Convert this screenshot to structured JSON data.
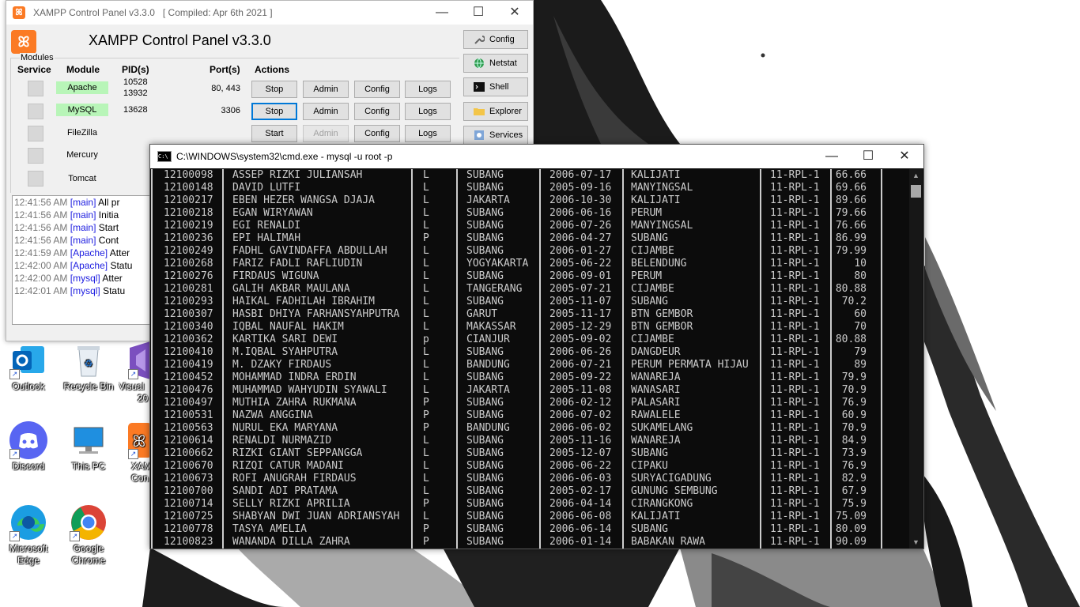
{
  "xampp": {
    "window_title": "XAMPP Control Panel v3.3.0   [ Compiled: Apr 6th 2021 ]",
    "heading": "XAMPP Control Panel v3.3.0",
    "modules_label": "Modules",
    "headers": {
      "service": "Service",
      "module": "Module",
      "pids": "PID(s)",
      "ports": "Port(s)",
      "actions": "Actions"
    },
    "modules": [
      {
        "name": "Apache",
        "running": true,
        "pid1": "10528",
        "pid2": "13932",
        "port": "80, 443",
        "toggle": "Stop",
        "admin": "Admin",
        "config": "Config",
        "logs": "Logs"
      },
      {
        "name": "MySQL",
        "running": true,
        "pid1": "13628",
        "pid2": "",
        "port": "3306",
        "toggle": "Stop",
        "admin": "Admin",
        "config": "Config",
        "logs": "Logs"
      },
      {
        "name": "FileZilla",
        "running": false,
        "pid1": "",
        "pid2": "",
        "port": "",
        "toggle": "Start",
        "admin": "Admin",
        "config": "Config",
        "logs": "Logs"
      },
      {
        "name": "Mercury",
        "running": false
      },
      {
        "name": "Tomcat",
        "running": false
      }
    ],
    "side_buttons": [
      "Config",
      "Netstat",
      "Shell",
      "Explorer",
      "Services"
    ],
    "log": [
      {
        "time": "12:41:56 AM",
        "module": "[main]",
        "text": "All pr"
      },
      {
        "time": "12:41:56 AM",
        "module": "[main]",
        "text": "Initia"
      },
      {
        "time": "12:41:56 AM",
        "module": "[main]",
        "text": "Start"
      },
      {
        "time": "12:41:56 AM",
        "module": "[main]",
        "text": "Cont"
      },
      {
        "time": "12:41:59 AM",
        "module": "[Apache]",
        "text": "Atter"
      },
      {
        "time": "12:42:00 AM",
        "module": "[Apache]",
        "text": "Statu"
      },
      {
        "time": "12:42:00 AM",
        "module": "[mysql]",
        "text": "Atter"
      },
      {
        "time": "12:42:01 AM",
        "module": "[mysql]",
        "text": "Statu"
      }
    ]
  },
  "cmd": {
    "title": "C:\\WINDOWS\\system32\\cmd.exe - mysql  -u root -p",
    "rows": [
      [
        "12100098",
        "ASSEP RIZKI JULIANSAH",
        "L",
        "SUBANG",
        "2006-07-17",
        "KALIJATI",
        "11-RPL-1",
        "66.66"
      ],
      [
        "12100148",
        "DAVID LUTFI",
        "L",
        "SUBANG",
        "2005-09-16",
        "MANYINGSAL",
        "11-RPL-1",
        "69.66"
      ],
      [
        "12100217",
        "EBEN HEZER WANGSA DJAJA",
        "L",
        "JAKARTA",
        "2006-10-30",
        "KALIJATI",
        "11-RPL-1",
        "89.66"
      ],
      [
        "12100218",
        "EGAN WIRYAWAN",
        "L",
        "SUBANG",
        "2006-06-16",
        "PERUM",
        "11-RPL-1",
        "79.66"
      ],
      [
        "12100219",
        "EGI RENALDI",
        "L",
        "SUBANG",
        "2006-07-26",
        "MANYINGSAL",
        "11-RPL-1",
        "76.66"
      ],
      [
        "12100236",
        "EPI HALIMAH",
        "P",
        "SUBANG",
        "2006-04-27",
        "SUBANG",
        "11-RPL-1",
        "86.99"
      ],
      [
        "12100249",
        "FADHL GAVINDAFFA ABDULLAH",
        "L",
        "SUBANG",
        "2006-01-27",
        "CIJAMBE",
        "11-RPL-1",
        "79.99"
      ],
      [
        "12100268",
        "FARIZ FADLI RAFLIUDIN",
        "L",
        "YOGYAKARTA",
        "2005-06-22",
        "BELENDUNG",
        "11-RPL-1",
        "10"
      ],
      [
        "12100276",
        "FIRDAUS WIGUNA",
        "L",
        "SUBANG",
        "2006-09-01",
        "PERUM",
        "11-RPL-1",
        "80"
      ],
      [
        "12100281",
        "GALIH AKBAR MAULANA",
        "L",
        "TANGERANG",
        "2005-07-21",
        "CIJAMBE",
        "11-RPL-1",
        "80.88"
      ],
      [
        "12100293",
        "HAIKAL FADHILAH IBRAHIM",
        "L",
        "SUBANG",
        "2005-11-07",
        "SUBANG",
        "11-RPL-1",
        "70.2"
      ],
      [
        "12100307",
        "HASBI DHIYA FARHANSYAHPUTRA",
        "L",
        "GARUT",
        "2005-11-17",
        "BTN GEMBOR",
        "11-RPL-1",
        "60"
      ],
      [
        "12100340",
        "IQBAL NAUFAL HAKIM",
        "L",
        "MAKASSAR",
        "2005-12-29",
        "BTN GEMBOR",
        "11-RPL-1",
        "70"
      ],
      [
        "12100362",
        "KARTIKA SARI DEWI",
        "p",
        "CIANJUR",
        "2005-09-02",
        "CIJAMBE",
        "11-RPL-1",
        "80.88"
      ],
      [
        "12100410",
        "M.IQBAL SYAHPUTRA",
        "L",
        "SUBANG",
        "2006-06-26",
        "DANGDEUR",
        "11-RPL-1",
        "79"
      ],
      [
        "12100419",
        "M. DZAKY FIRDAUS",
        "L",
        "BANDUNG",
        "2006-07-21",
        "PERUM PERMATA HIJAU",
        "11-RPL-1",
        "89"
      ],
      [
        "12100452",
        "MOHAMMAD INDRA ERDIN",
        "L",
        "SUBANG",
        "2005-09-22",
        "WANAREJA",
        "11-RPL-1",
        "79.9"
      ],
      [
        "12100476",
        "MUHAMMAD WAHYUDIN SYAWALI",
        "L",
        "JAKARTA",
        "2005-11-08",
        "WANASARI",
        "11-RPL-1",
        "70.9"
      ],
      [
        "12100497",
        "MUTHIA ZAHRA RUKMANA",
        "P",
        "SUBANG",
        "2006-02-12",
        "PALASARI",
        "11-RPL-1",
        "76.9"
      ],
      [
        "12100531",
        "NAZWA ANGGINA",
        "P",
        "SUBANG",
        "2006-07-02",
        "RAWALELE",
        "11-RPL-1",
        "60.9"
      ],
      [
        "12100563",
        "NURUL EKA MARYANA",
        "P",
        "BANDUNG",
        "2006-06-02",
        "SUKAMELANG",
        "11-RPL-1",
        "70.9"
      ],
      [
        "12100614",
        "RENALDI NURMAZID",
        "L",
        "SUBANG",
        "2005-11-16",
        "WANAREJA",
        "11-RPL-1",
        "84.9"
      ],
      [
        "12100662",
        "RIZKI GIANT SEPPANGGA",
        "L",
        "SUBANG",
        "2005-12-07",
        "SUBANG",
        "11-RPL-1",
        "73.9"
      ],
      [
        "12100670",
        "RIZQI CATUR MADANI",
        "L",
        "SUBANG",
        "2006-06-22",
        "CIPAKU",
        "11-RPL-1",
        "76.9"
      ],
      [
        "12100673",
        "ROFI ANUGRAH FIRDAUS",
        "L",
        "SUBANG",
        "2006-06-03",
        "SURYACIGADUNG",
        "11-RPL-1",
        "82.9"
      ],
      [
        "12100700",
        "SANDI ADI PRATAMA",
        "L",
        "SUBANG",
        "2005-02-17",
        "GUNUNG SEMBUNG",
        "11-RPL-1",
        "67.9"
      ],
      [
        "12100714",
        "SELLY RIZKI APRILIA",
        "P",
        "SUBANG",
        "2006-04-14",
        "CIRANGKONG",
        "11-RPL-1",
        "75.9"
      ],
      [
        "12100725",
        "SHABYAN DWI JUAN ADRIANSYAH",
        "L",
        "SUBANG",
        "2006-06-08",
        "KALIJATI",
        "11-RPL-1",
        "75.09"
      ],
      [
        "12100778",
        "TASYA AMELIA",
        "P",
        "SUBANG",
        "2006-06-14",
        "SUBANG",
        "11-RPL-1",
        "80.09"
      ],
      [
        "12100823",
        "WANANDA DILLA ZAHRA",
        "P",
        "SUBANG",
        "2006-01-14",
        "BABAKAN RAWA",
        "11-RPL-1",
        "90.09"
      ]
    ]
  },
  "desktop": {
    "icons": [
      {
        "label1": "Outlook",
        "label2": "",
        "icon": "outlook-icon"
      },
      {
        "label1": "Recycle Bin",
        "label2": "",
        "icon": "recycle-bin-icon"
      },
      {
        "label1": "Visual",
        "label2": "20",
        "icon": "visual-studio-icon"
      },
      {
        "label1": "Discord",
        "label2": "",
        "icon": "discord-icon"
      },
      {
        "label1": "This PC",
        "label2": "",
        "icon": "this-pc-icon"
      },
      {
        "label1": "XAM",
        "label2": "Con",
        "icon": "xampp-icon"
      },
      {
        "label1": "Microsoft",
        "label2": "Edge",
        "icon": "edge-icon"
      },
      {
        "label1": "Google",
        "label2": "Chrome",
        "icon": "chrome-icon"
      }
    ]
  },
  "colors": {
    "xampp_orange": "#fb7a24",
    "running_green": "#b8f5b8",
    "log_blue": "#1d1de0",
    "console_bg": "#0c0c0c",
    "console_text": "#cccccc"
  }
}
